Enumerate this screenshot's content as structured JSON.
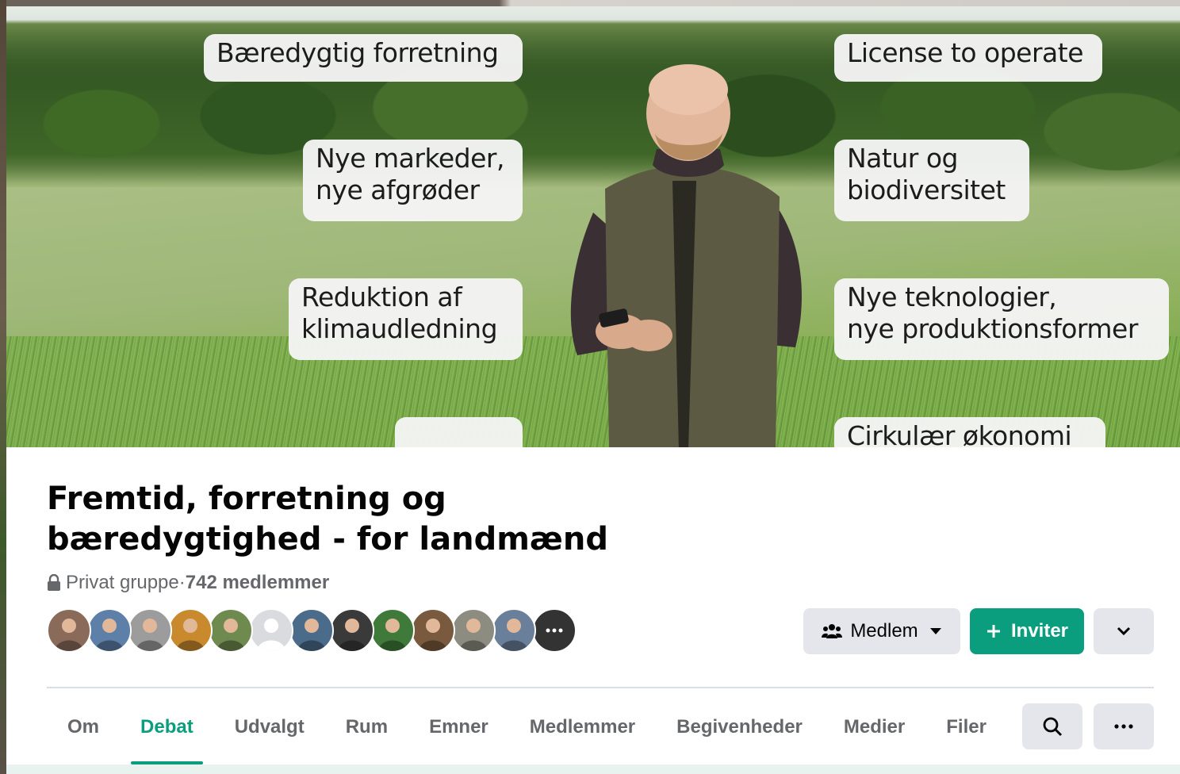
{
  "cover": {
    "bubbles_left": [
      "Bæredygtig forretning",
      "Nye markeder,\nnye afgrøder",
      "Reduktion af\nklimaudledning"
    ],
    "bubbles_right": [
      "License to operate",
      "Natur og\nbiodiversitet",
      "Nye teknologier,\nnye produktionsformer",
      "Cirkulær økonomi"
    ]
  },
  "group": {
    "title": "Fremtid, forretning og\nbæredygtighed - for landmænd",
    "privacy": "Privat gruppe",
    "separator": " · ",
    "members": "742 medlemmer"
  },
  "avatars": [
    {
      "name": "member-avatar",
      "color": "#8a6b5a"
    },
    {
      "name": "member-avatar",
      "color": "#5d7fa8"
    },
    {
      "name": "member-avatar",
      "color": "#9c9c9c"
    },
    {
      "name": "member-avatar",
      "color": "#c98a2e"
    },
    {
      "name": "member-avatar",
      "color": "#6f8a4e"
    },
    {
      "name": "member-avatar",
      "color": "#d9dbdf"
    },
    {
      "name": "member-avatar",
      "color": "#4a6b8a"
    },
    {
      "name": "member-avatar",
      "color": "#3a3a3a"
    },
    {
      "name": "member-avatar",
      "color": "#3f7a3a"
    },
    {
      "name": "member-avatar",
      "color": "#7a5a3e"
    },
    {
      "name": "member-avatar",
      "color": "#8c8c80"
    },
    {
      "name": "member-avatar",
      "color": "#6a7f9a"
    },
    {
      "name": "member-avatar-more",
      "color": "#333333"
    }
  ],
  "actions": {
    "member_label": "Medlem",
    "invite_label": "Inviter"
  },
  "tabs": [
    {
      "label": "Om",
      "active": false
    },
    {
      "label": "Debat",
      "active": true
    },
    {
      "label": "Udvalgt",
      "active": false
    },
    {
      "label": "Rum",
      "active": false
    },
    {
      "label": "Emner",
      "active": false
    },
    {
      "label": "Medlemmer",
      "active": false
    },
    {
      "label": "Begivenheder",
      "active": false
    },
    {
      "label": "Medier",
      "active": false
    },
    {
      "label": "Filer",
      "active": false
    }
  ],
  "colors": {
    "accent": "#0a9e7e",
    "button_gray": "#e4e6eb",
    "text_secondary": "#65676b"
  }
}
